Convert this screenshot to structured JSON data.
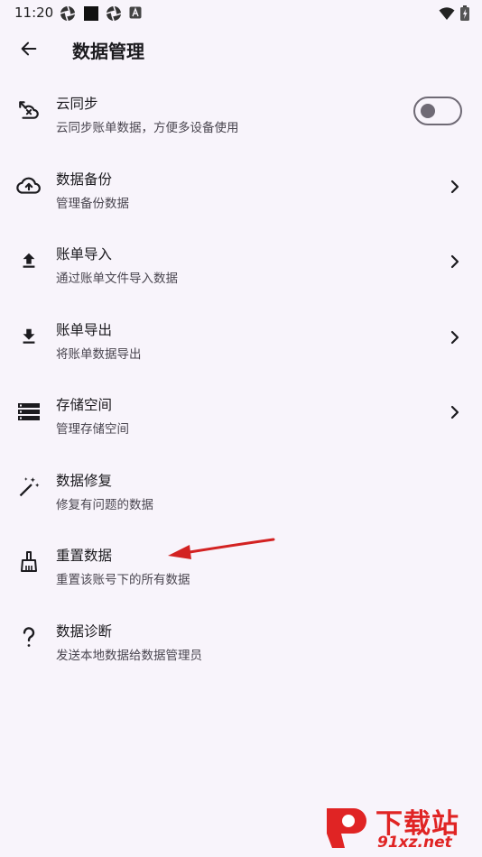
{
  "status_bar": {
    "time": "11:20",
    "left_icons": [
      "aperture-icon",
      "square-app-icon",
      "aperture-icon",
      "a-box-icon"
    ],
    "right_icons": [
      "wifi-icon",
      "battery-charging-icon"
    ]
  },
  "app_bar": {
    "back_icon": "arrow-left-icon",
    "title": "数据管理"
  },
  "items": [
    {
      "icon": "cloud-sync-icon",
      "title": "云同步",
      "subtitle": "云同步账单数据，方便多设备使用",
      "control": "toggle",
      "toggle_on": false
    },
    {
      "icon": "cloud-upload-icon",
      "title": "数据备份",
      "subtitle": "管理备份数据",
      "control": "chevron"
    },
    {
      "icon": "upload-icon",
      "title": "账单导入",
      "subtitle": "通过账单文件导入数据",
      "control": "chevron"
    },
    {
      "icon": "download-icon",
      "title": "账单导出",
      "subtitle": "将账单数据导出",
      "control": "chevron"
    },
    {
      "icon": "storage-icon",
      "title": "存储空间",
      "subtitle": "管理存储空间",
      "control": "chevron"
    },
    {
      "icon": "magic-wand-icon",
      "title": "数据修复",
      "subtitle": "修复有问题的数据",
      "control": "none"
    },
    {
      "icon": "broom-icon",
      "title": "重置数据",
      "subtitle": "重置该账号下的所有数据",
      "control": "none"
    },
    {
      "icon": "question-icon",
      "title": "数据诊断",
      "subtitle": "发送本地数据给数据管理员",
      "control": "none"
    }
  ],
  "annotation": {
    "color": "#d32222",
    "points_to": "重置数据"
  },
  "watermark": {
    "main": "下载站",
    "sub": "91xz.net",
    "color": "#e02424"
  }
}
